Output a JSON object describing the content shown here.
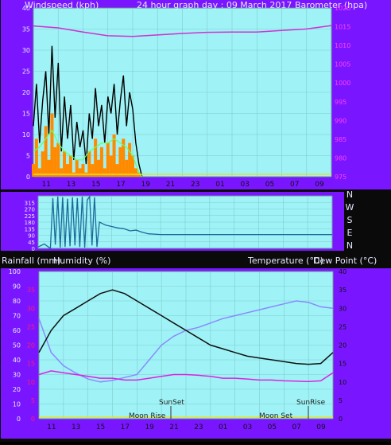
{
  "header": {
    "left_title": "Windspeed (kph)",
    "center_title": "24 hour graph day : 09 March 2017",
    "right_title": "Barometer (hpa)"
  },
  "lower_header": {
    "rainfall": "Rainfall (mm)",
    "humidity": "Humidity (%)",
    "temperature": "Temperature (°C)",
    "dewpoint": "Dew Point (°C)"
  },
  "annotations": {
    "sunset": "SunSet",
    "sunrise": "SunRise",
    "moonrise": "Moon Rise",
    "moonset": "Moon Set"
  },
  "colors": {
    "plot_bg": "#9ff3f6",
    "panel_bg": "#7a16ff",
    "wind_line": "#000000",
    "wind_gust": "#ff8a00",
    "wind_avg": "#66ff66",
    "pressure_line": "#d030d0",
    "direction_line": "#1a6a9a",
    "temperature_line": "#111111",
    "humidity_line": "#8a8aff",
    "dewpoint_line": "#e020e0",
    "left_axis_text": "#e6e6ff",
    "right_axis_red": "#ff1a7a",
    "right_axis_pressure": "#ff40ff"
  },
  "chart_data": [
    {
      "type": "line",
      "title": "24 hour graph day : 09 March 2017",
      "x_ticks": [
        "11",
        "13",
        "15",
        "17",
        "19",
        "21",
        "23",
        "01",
        "03",
        "05",
        "07",
        "09"
      ],
      "left_axis": {
        "label": "Windspeed (kph)",
        "ylim": [
          0,
          40
        ],
        "ticks": [
          0,
          5,
          10,
          15,
          20,
          25,
          30,
          35,
          40
        ]
      },
      "right_axis": {
        "label": "Barometer (hpa)",
        "ylim": [
          975,
          1020
        ],
        "ticks": [
          975,
          980,
          985,
          990,
          995,
          1000,
          1005,
          1010,
          1015,
          1020
        ]
      },
      "series": [
        {
          "axis": "right",
          "x_hours": [
            0,
            2,
            4,
            6,
            8,
            10,
            12,
            14,
            16,
            18,
            20,
            22,
            24
          ],
          "values": [
            1015.2,
            1014.7,
            1013.6,
            1012.6,
            1012.4,
            1012.8,
            1013.2,
            1013.5,
            1013.6,
            1013.6,
            1014.0,
            1014.4,
            1015.3
          ]
        },
        {
          "axis": "left",
          "x_hours": [
            0,
            0.25,
            0.5,
            0.75,
            1,
            1.25,
            1.5,
            1.75,
            2,
            2.25,
            2.5,
            2.75,
            3,
            3.25,
            3.5,
            3.75,
            4,
            4.25,
            4.5,
            4.75,
            5,
            5.25,
            5.5,
            5.75,
            6,
            6.25,
            6.5,
            6.75,
            7,
            7.25,
            7.5,
            7.75,
            8,
            8.25,
            8.5,
            8.75
          ],
          "values": [
            12,
            22,
            8,
            18,
            25,
            10,
            31,
            14,
            27,
            6,
            19,
            9,
            17,
            4,
            13,
            7,
            11,
            3,
            15,
            9,
            21,
            12,
            17,
            8,
            19,
            15,
            22,
            10,
            18,
            24,
            12,
            20,
            16,
            8,
            3,
            0
          ]
        },
        {
          "axis": "left",
          "x_hours": [
            0,
            0.25,
            0.5,
            0.75,
            1,
            1.25,
            1.5,
            1.75,
            2,
            2.25,
            2.5,
            2.75,
            3,
            3.25,
            3.5,
            3.75,
            4,
            4.25,
            4.5,
            4.75,
            5,
            5.25,
            5.5,
            5.75,
            6,
            6.25,
            6.5,
            6.75,
            7,
            7.25,
            7.5,
            7.75,
            8,
            8.25,
            8.5,
            8.75
          ],
          "values": [
            3,
            9,
            2,
            6,
            12,
            4,
            15,
            7,
            8,
            2,
            6,
            3,
            5,
            1,
            4,
            2,
            3,
            1,
            6,
            3,
            9,
            4,
            7,
            2,
            8,
            5,
            10,
            3,
            7,
            9,
            4,
            8,
            5,
            2,
            1,
            0
          ]
        },
        {
          "axis": "left",
          "x_hours": [
            0,
            0.5,
            1,
            1.5,
            2,
            2.5,
            3,
            3.5,
            4,
            4.5,
            5,
            5.5,
            6,
            6.5,
            7,
            7.5,
            8,
            8.5,
            8.75
          ],
          "values": [
            6,
            7,
            9,
            11,
            8,
            6,
            5,
            4,
            4,
            6,
            7,
            8,
            8,
            9,
            8,
            7,
            5,
            1,
            0
          ]
        }
      ]
    },
    {
      "type": "line",
      "title": "",
      "left_axis": {
        "ticks": [
          0,
          45,
          90,
          135,
          180,
          225,
          270,
          315,
          360
        ]
      },
      "right_axis_labels": [
        "N",
        "W",
        "S",
        "E",
        "N"
      ],
      "series": [
        {
          "x_hours": [
            0,
            0.5,
            1,
            1.2,
            1.4,
            1.6,
            1.8,
            2,
            2.2,
            2.4,
            2.6,
            2.8,
            3,
            3.2,
            3.4,
            3.6,
            3.8,
            4,
            4.2,
            4.4,
            4.6,
            4.8,
            5,
            5.5,
            6,
            6.5,
            7,
            7.5,
            8,
            8.5,
            9,
            10,
            12,
            16,
            20,
            24
          ],
          "values": [
            10,
            30,
            0,
            345,
            25,
            355,
            5,
            350,
            10,
            340,
            15,
            350,
            20,
            345,
            10,
            355,
            5,
            330,
            355,
            20,
            350,
            10,
            180,
            160,
            150,
            140,
            135,
            120,
            125,
            110,
            100,
            95,
            95,
            95,
            95,
            95
          ]
        }
      ]
    },
    {
      "type": "line",
      "title": "",
      "x_ticks": [
        "11",
        "13",
        "15",
        "17",
        "19",
        "21",
        "23",
        "01",
        "03",
        "05",
        "07",
        "09"
      ],
      "left_axis": {
        "label": "Humidity (%)",
        "ylim": [
          0,
          100
        ],
        "ticks": [
          0,
          10,
          20,
          30,
          40,
          50,
          60,
          70,
          80,
          90,
          100
        ]
      },
      "rain_axis": {
        "label": "Rainfall (mm)",
        "ticks": [
          0,
          5,
          10,
          15,
          20,
          25,
          30,
          35
        ]
      },
      "right_axis": {
        "label": "Temperature (°C)",
        "ylim": [
          0,
          40
        ],
        "ticks": [
          0,
          5,
          10,
          15,
          20,
          25,
          30,
          35,
          40
        ]
      },
      "series": [
        {
          "axis": "right",
          "x_hours": [
            0,
            1,
            2,
            3,
            4,
            5,
            6,
            7,
            8,
            9,
            10,
            11,
            12,
            13,
            14,
            15,
            16,
            17,
            18,
            19,
            20,
            21,
            22,
            23,
            24
          ],
          "values": [
            18,
            24,
            28,
            30,
            32,
            34,
            35,
            34,
            32,
            30,
            28,
            26,
            24,
            22,
            20,
            19,
            18,
            17,
            16.5,
            16,
            15.5,
            15,
            14.8,
            15,
            18
          ]
        },
        {
          "axis": "left",
          "x_hours": [
            0,
            1,
            2,
            3,
            4,
            5,
            6,
            7,
            8,
            9,
            10,
            11,
            12,
            13,
            14,
            15,
            16,
            17,
            18,
            19,
            20,
            21,
            22,
            23,
            24
          ],
          "values": [
            68,
            45,
            36,
            31,
            27,
            25,
            26,
            28,
            30,
            40,
            50,
            56,
            60,
            62,
            65,
            68,
            70,
            72,
            74,
            76,
            78,
            80,
            79,
            76,
            75
          ]
        },
        {
          "axis": "right",
          "x_hours": [
            0,
            1,
            2,
            3,
            4,
            5,
            6,
            7,
            8,
            9,
            10,
            11,
            12,
            13,
            14,
            15,
            16,
            17,
            18,
            19,
            20,
            21,
            22,
            23,
            24
          ],
          "values": [
            12,
            13,
            12.5,
            12,
            11.5,
            11,
            11,
            10.5,
            10.5,
            11,
            11.5,
            12,
            12,
            11.8,
            11.5,
            11,
            11,
            10.8,
            10.5,
            10.5,
            10.3,
            10.2,
            10.1,
            10.3,
            12.5
          ]
        }
      ]
    }
  ]
}
